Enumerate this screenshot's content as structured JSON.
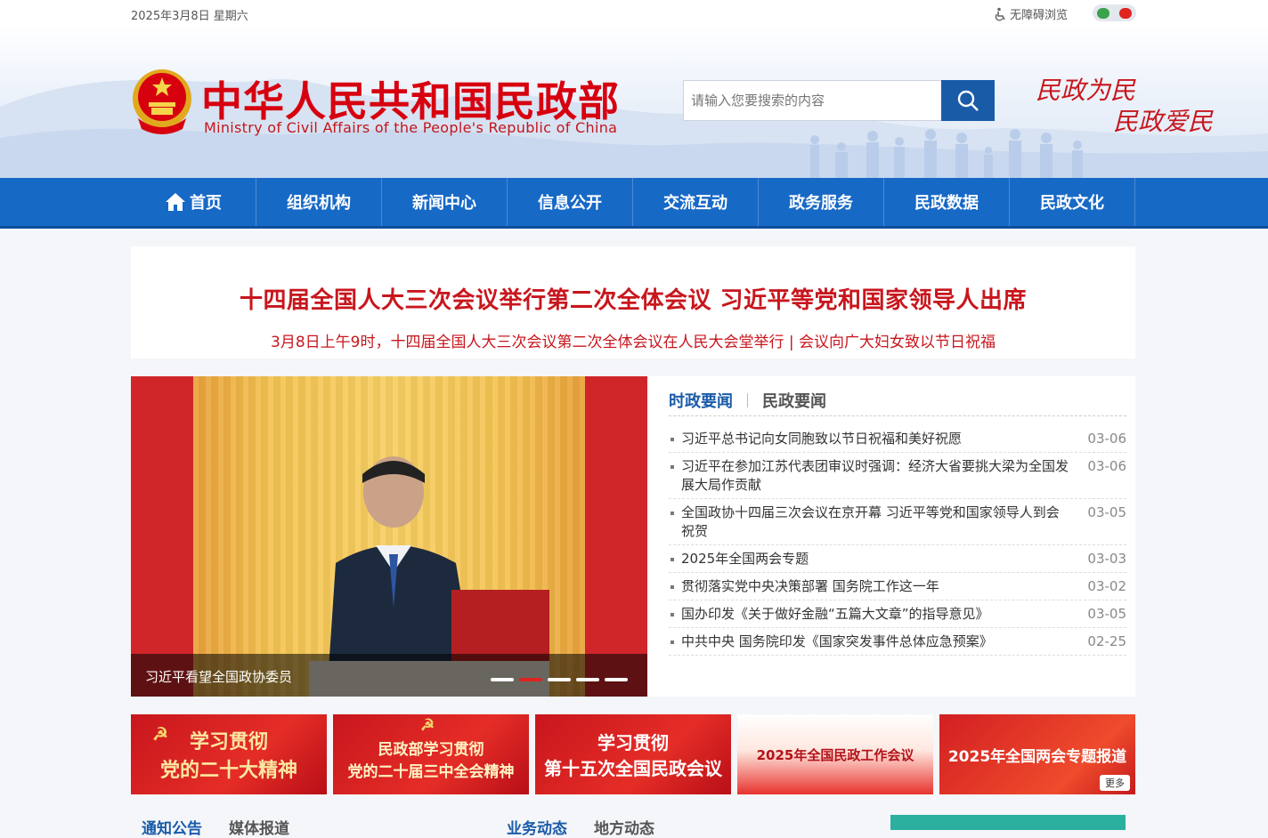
{
  "topbar": {
    "date": "2025年3月8日 星期六",
    "accessibility": "无障碍浏览",
    "accessibility_icon": "wheelchair-icon",
    "social_icons": [
      "wechat-icon",
      "weibo-icon"
    ]
  },
  "header": {
    "title_cn": "中华人民共和国民政部",
    "title_en": "Ministry of Civil Affairs of the People's Republic of China",
    "search_placeholder": "请输入您要搜索的内容",
    "search_icon": "search-icon",
    "slogan_line1": "民政为民",
    "slogan_line2": "民政爱民"
  },
  "nav": {
    "items": [
      {
        "label": "首页",
        "icon": "home-icon"
      },
      {
        "label": "组织机构"
      },
      {
        "label": "新闻中心"
      },
      {
        "label": "信息公开"
      },
      {
        "label": "交流互动"
      },
      {
        "label": "政务服务"
      },
      {
        "label": "民政数据"
      },
      {
        "label": "民政文化"
      }
    ]
  },
  "headline": {
    "title": "十四届全国人大三次会议举行第二次全体会议 习近平等党和国家领导人出席",
    "subtitle": "3月8日上午9时，十四届全国人大三次会议第二次全体会议在人民大会堂举行 | 会议向广大妇女致以节日祝福"
  },
  "slider": {
    "caption": "习近平看望全国政协委员",
    "dot_count": 5,
    "active_dot": 2
  },
  "news": {
    "tabs": [
      "时政要闻",
      "民政要闻"
    ],
    "items": [
      {
        "title": "习近平总书记向女同胞致以节日祝福和美好祝愿",
        "date": "03-06"
      },
      {
        "title": "习近平在参加江苏代表团审议时强调：经济大省要挑大梁为全国发展大局作贡献",
        "date": "03-06"
      },
      {
        "title": "全国政协十四届三次会议在京开幕 习近平等党和国家领导人到会祝贺",
        "date": "03-05"
      },
      {
        "title": "2025年全国两会专题",
        "date": "03-03"
      },
      {
        "title": "贯彻落实党中央决策部署 国务院工作这一年",
        "date": "03-02"
      },
      {
        "title": "国办印发《关于做好金融“五篇大文章”的指导意见》",
        "date": "03-05"
      },
      {
        "title": "中共中央 国务院印发《国家突发事件总体应急预案》",
        "date": "02-25"
      }
    ]
  },
  "banners": [
    {
      "line1": "学习贯彻",
      "line2": "党的二十大精神"
    },
    {
      "line1": "民政部学习贯彻",
      "line2": "党的二十届三中全会精神"
    },
    {
      "line1": "学习贯彻",
      "line2": "第十五次全国民政会议"
    },
    {
      "line1": "2025年全国民政工作会议",
      "line2": ""
    },
    {
      "line1": "2025年全国两会专题报道",
      "line2": "",
      "more": "更多"
    }
  ],
  "bottom_tabs": {
    "left": [
      "通知公告",
      "媒体报道"
    ],
    "middle": [
      "业务动态",
      "地方动态"
    ]
  },
  "colors": {
    "brand_red": "#d7000f",
    "nav_blue": "#1769c6",
    "search_blue": "#1a5ba8"
  }
}
